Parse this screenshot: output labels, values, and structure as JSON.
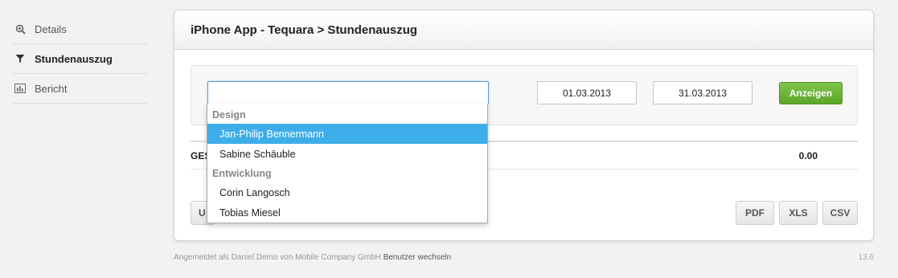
{
  "sidebar": {
    "items": [
      {
        "label": "Details",
        "icon": "zoom-icon"
      },
      {
        "label": "Stundenauszug",
        "icon": "filter-icon"
      },
      {
        "label": "Bericht",
        "icon": "bar-chart-icon"
      }
    ]
  },
  "panel": {
    "title": "iPhone App - Tequara > Stundenauszug"
  },
  "filter": {
    "person_value": "",
    "date_from": "01.03.2013",
    "date_to": "31.03.2013",
    "show_label": "Anzeigen"
  },
  "dropdown": {
    "groups": [
      {
        "label": "Design",
        "options": [
          "Jan-Philip Bennermann",
          "Sabine Schäuble"
        ]
      },
      {
        "label": "Entwicklung",
        "options": [
          "Corin Langosch",
          "Tobias Miesel"
        ]
      }
    ],
    "selected": "Jan-Philip Bennermann"
  },
  "total": {
    "label_visible": "GES",
    "value": "0.00"
  },
  "buttons": {
    "u_label": "U",
    "pdf": "PDF",
    "xls": "XLS",
    "csv": "CSV"
  },
  "footer": {
    "text": "Angemeldet als Daniel Demo von Mobile Company GmbH",
    "link": "Benutzer wechseln",
    "version": "13.6"
  },
  "colors": {
    "accent_green": "#5ca52a",
    "selected_blue": "#3daee9",
    "focus_blue": "#5b9dd9"
  }
}
